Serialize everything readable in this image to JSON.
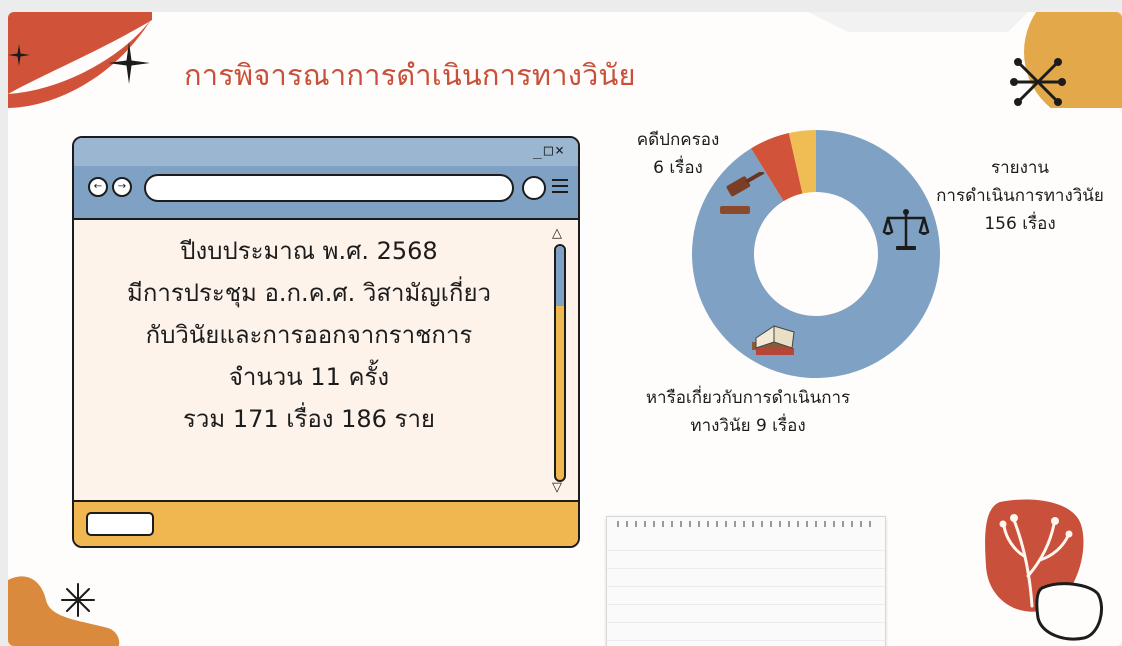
{
  "slide": {
    "title": "การพิจารณาการดำเนินการทางวินัย"
  },
  "window": {
    "controls": "_□×",
    "nav_back": "←",
    "nav_forward": "→",
    "body_lines": [
      "ปีงบประมาณ พ.ศ. 2568",
      "มีการประชุม อ.ก.ค.ศ. วิสามัญเกี่ยว",
      "กับวินัยและการออกจากราชการ",
      "จำนวน 11 ครั้ง",
      "รวม 171 เรื่อง 186 ราย"
    ],
    "scroll_up": "△",
    "scroll_down": "▽",
    "scroll_position": 0.0
  },
  "chart_data": {
    "type": "pie",
    "style": "donut",
    "segments": [
      {
        "label_lines": [
          "รายงาน",
          "การดำเนินการทางวินัย",
          "156 เรื่อง"
        ],
        "value": 156,
        "color": "#7ea1c4",
        "icon": "scales-icon"
      },
      {
        "label_lines": [
          "หารือเกี่ยวกับการดำเนินการ",
          "ทางวินัย 9 เรื่อง"
        ],
        "value": 9,
        "color": "#d0533a",
        "icon": "books-icon"
      },
      {
        "label_lines": [
          "คดีปกครอง",
          "6 เรื่อง"
        ],
        "value": 6,
        "color": "#f0bd55",
        "icon": "gavel-icon"
      }
    ]
  },
  "colors": {
    "accent_red": "#c85038",
    "accent_blue": "#7ea1c4",
    "accent_yellow": "#f0b750"
  }
}
